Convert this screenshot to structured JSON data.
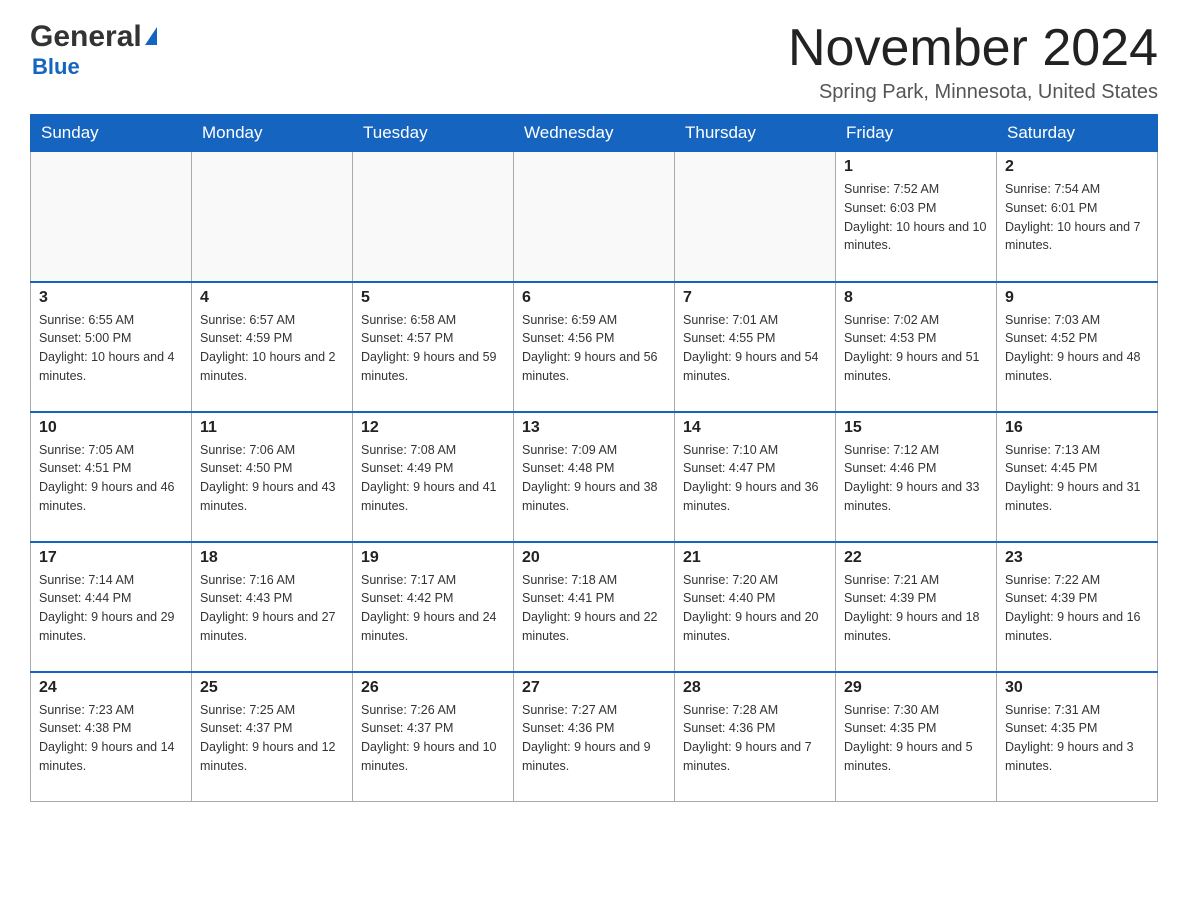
{
  "header": {
    "logo_general": "General",
    "logo_blue": "Blue",
    "month_title": "November 2024",
    "location": "Spring Park, Minnesota, United States"
  },
  "weekdays": [
    "Sunday",
    "Monday",
    "Tuesday",
    "Wednesday",
    "Thursday",
    "Friday",
    "Saturday"
  ],
  "weeks": [
    [
      {
        "day": "",
        "sunrise": "",
        "sunset": "",
        "daylight": ""
      },
      {
        "day": "",
        "sunrise": "",
        "sunset": "",
        "daylight": ""
      },
      {
        "day": "",
        "sunrise": "",
        "sunset": "",
        "daylight": ""
      },
      {
        "day": "",
        "sunrise": "",
        "sunset": "",
        "daylight": ""
      },
      {
        "day": "",
        "sunrise": "",
        "sunset": "",
        "daylight": ""
      },
      {
        "day": "1",
        "sunrise": "Sunrise: 7:52 AM",
        "sunset": "Sunset: 6:03 PM",
        "daylight": "Daylight: 10 hours and 10 minutes."
      },
      {
        "day": "2",
        "sunrise": "Sunrise: 7:54 AM",
        "sunset": "Sunset: 6:01 PM",
        "daylight": "Daylight: 10 hours and 7 minutes."
      }
    ],
    [
      {
        "day": "3",
        "sunrise": "Sunrise: 6:55 AM",
        "sunset": "Sunset: 5:00 PM",
        "daylight": "Daylight: 10 hours and 4 minutes."
      },
      {
        "day": "4",
        "sunrise": "Sunrise: 6:57 AM",
        "sunset": "Sunset: 4:59 PM",
        "daylight": "Daylight: 10 hours and 2 minutes."
      },
      {
        "day": "5",
        "sunrise": "Sunrise: 6:58 AM",
        "sunset": "Sunset: 4:57 PM",
        "daylight": "Daylight: 9 hours and 59 minutes."
      },
      {
        "day": "6",
        "sunrise": "Sunrise: 6:59 AM",
        "sunset": "Sunset: 4:56 PM",
        "daylight": "Daylight: 9 hours and 56 minutes."
      },
      {
        "day": "7",
        "sunrise": "Sunrise: 7:01 AM",
        "sunset": "Sunset: 4:55 PM",
        "daylight": "Daylight: 9 hours and 54 minutes."
      },
      {
        "day": "8",
        "sunrise": "Sunrise: 7:02 AM",
        "sunset": "Sunset: 4:53 PM",
        "daylight": "Daylight: 9 hours and 51 minutes."
      },
      {
        "day": "9",
        "sunrise": "Sunrise: 7:03 AM",
        "sunset": "Sunset: 4:52 PM",
        "daylight": "Daylight: 9 hours and 48 minutes."
      }
    ],
    [
      {
        "day": "10",
        "sunrise": "Sunrise: 7:05 AM",
        "sunset": "Sunset: 4:51 PM",
        "daylight": "Daylight: 9 hours and 46 minutes."
      },
      {
        "day": "11",
        "sunrise": "Sunrise: 7:06 AM",
        "sunset": "Sunset: 4:50 PM",
        "daylight": "Daylight: 9 hours and 43 minutes."
      },
      {
        "day": "12",
        "sunrise": "Sunrise: 7:08 AM",
        "sunset": "Sunset: 4:49 PM",
        "daylight": "Daylight: 9 hours and 41 minutes."
      },
      {
        "day": "13",
        "sunrise": "Sunrise: 7:09 AM",
        "sunset": "Sunset: 4:48 PM",
        "daylight": "Daylight: 9 hours and 38 minutes."
      },
      {
        "day": "14",
        "sunrise": "Sunrise: 7:10 AM",
        "sunset": "Sunset: 4:47 PM",
        "daylight": "Daylight: 9 hours and 36 minutes."
      },
      {
        "day": "15",
        "sunrise": "Sunrise: 7:12 AM",
        "sunset": "Sunset: 4:46 PM",
        "daylight": "Daylight: 9 hours and 33 minutes."
      },
      {
        "day": "16",
        "sunrise": "Sunrise: 7:13 AM",
        "sunset": "Sunset: 4:45 PM",
        "daylight": "Daylight: 9 hours and 31 minutes."
      }
    ],
    [
      {
        "day": "17",
        "sunrise": "Sunrise: 7:14 AM",
        "sunset": "Sunset: 4:44 PM",
        "daylight": "Daylight: 9 hours and 29 minutes."
      },
      {
        "day": "18",
        "sunrise": "Sunrise: 7:16 AM",
        "sunset": "Sunset: 4:43 PM",
        "daylight": "Daylight: 9 hours and 27 minutes."
      },
      {
        "day": "19",
        "sunrise": "Sunrise: 7:17 AM",
        "sunset": "Sunset: 4:42 PM",
        "daylight": "Daylight: 9 hours and 24 minutes."
      },
      {
        "day": "20",
        "sunrise": "Sunrise: 7:18 AM",
        "sunset": "Sunset: 4:41 PM",
        "daylight": "Daylight: 9 hours and 22 minutes."
      },
      {
        "day": "21",
        "sunrise": "Sunrise: 7:20 AM",
        "sunset": "Sunset: 4:40 PM",
        "daylight": "Daylight: 9 hours and 20 minutes."
      },
      {
        "day": "22",
        "sunrise": "Sunrise: 7:21 AM",
        "sunset": "Sunset: 4:39 PM",
        "daylight": "Daylight: 9 hours and 18 minutes."
      },
      {
        "day": "23",
        "sunrise": "Sunrise: 7:22 AM",
        "sunset": "Sunset: 4:39 PM",
        "daylight": "Daylight: 9 hours and 16 minutes."
      }
    ],
    [
      {
        "day": "24",
        "sunrise": "Sunrise: 7:23 AM",
        "sunset": "Sunset: 4:38 PM",
        "daylight": "Daylight: 9 hours and 14 minutes."
      },
      {
        "day": "25",
        "sunrise": "Sunrise: 7:25 AM",
        "sunset": "Sunset: 4:37 PM",
        "daylight": "Daylight: 9 hours and 12 minutes."
      },
      {
        "day": "26",
        "sunrise": "Sunrise: 7:26 AM",
        "sunset": "Sunset: 4:37 PM",
        "daylight": "Daylight: 9 hours and 10 minutes."
      },
      {
        "day": "27",
        "sunrise": "Sunrise: 7:27 AM",
        "sunset": "Sunset: 4:36 PM",
        "daylight": "Daylight: 9 hours and 9 minutes."
      },
      {
        "day": "28",
        "sunrise": "Sunrise: 7:28 AM",
        "sunset": "Sunset: 4:36 PM",
        "daylight": "Daylight: 9 hours and 7 minutes."
      },
      {
        "day": "29",
        "sunrise": "Sunrise: 7:30 AM",
        "sunset": "Sunset: 4:35 PM",
        "daylight": "Daylight: 9 hours and 5 minutes."
      },
      {
        "day": "30",
        "sunrise": "Sunrise: 7:31 AM",
        "sunset": "Sunset: 4:35 PM",
        "daylight": "Daylight: 9 hours and 3 minutes."
      }
    ]
  ]
}
